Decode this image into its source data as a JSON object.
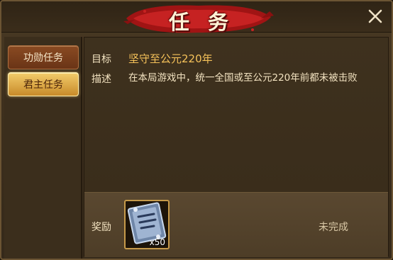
{
  "window": {
    "title": "任务"
  },
  "sidebar": {
    "tabs": [
      {
        "label": "功勋任务",
        "active": false
      },
      {
        "label": "君主任务",
        "active": true
      }
    ]
  },
  "quest": {
    "goal_label": "目标",
    "goal_text": "坚守至公元220年",
    "desc_label": "描述",
    "desc_text": "在本局游戏中，统一全国或至公元220年前都未被击败"
  },
  "reward": {
    "label": "奖励",
    "item_icon": "experience-scroll-icon",
    "item_count": "x50",
    "status": "未完成"
  },
  "colors": {
    "accent_gold": "#f6c25a",
    "banner_red": "#b01818",
    "text_light": "#f2e2c0"
  }
}
